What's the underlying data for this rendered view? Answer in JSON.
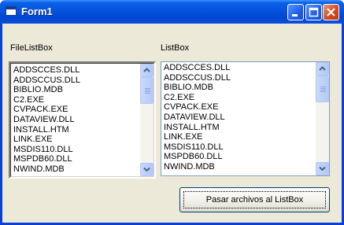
{
  "window": {
    "title": "Form1",
    "icon": "form-icon"
  },
  "file_list_box": {
    "label": "FileListBox",
    "items": [
      "ADDSCCES.DLL",
      "ADDSCCUS.DLL",
      "BIBLIO.MDB",
      "C2.EXE",
      "CVPACK.EXE",
      "DATAVIEW.DLL",
      "INSTALL.HTM",
      "LINK.EXE",
      "MSDIS110.DLL",
      "MSPDB60.DLL",
      "NWIND.MDB"
    ]
  },
  "list_box": {
    "label": "ListBox",
    "items": [
      "ADDSCCES.DLL",
      "ADDSCCUS.DLL",
      "BIBLIO.MDB",
      "C2.EXE",
      "CVPACK.EXE",
      "DATAVIEW.DLL",
      "INSTALL.HTM",
      "LINK.EXE",
      "MSDIS110.DLL",
      "MSPDB60.DLL",
      "NWIND.MDB"
    ]
  },
  "button": {
    "label": "Pasar archivos al ListBox"
  }
}
